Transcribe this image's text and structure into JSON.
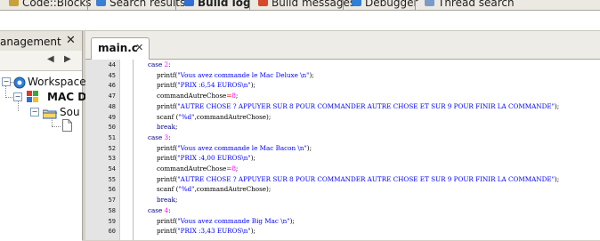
{
  "top_tabs": [
    {
      "label": "Code::Blocks",
      "icon": "codeblocks-icon",
      "active": false
    },
    {
      "label": "Search results",
      "icon": "search-results-icon",
      "active": false
    },
    {
      "label": "Build log",
      "icon": "build-log-icon",
      "active": true
    },
    {
      "label": "Build messages",
      "icon": "build-messages-icon",
      "active": false
    },
    {
      "label": "Debugger",
      "icon": "debugger-icon",
      "active": false
    },
    {
      "label": "Thread search",
      "icon": "thread-search-icon",
      "active": false
    }
  ],
  "management": {
    "title": "anagement",
    "close": "✕",
    "nav_prev": "◀",
    "nav_next": "▶",
    "tree": {
      "workspace": "Workspace",
      "project": "MAC D",
      "sources": "Sou"
    }
  },
  "editor": {
    "file_tab": "main.c",
    "file_tab_close": "✕",
    "lines": [
      {
        "n": "44",
        "indent": 0,
        "parts": [
          {
            "t": "case ",
            "c": "kw"
          },
          {
            "t": "2",
            "c": "num"
          },
          {
            "t": ":",
            "c": "pl"
          }
        ]
      },
      {
        "n": "45",
        "indent": 1,
        "parts": [
          {
            "t": "printf(",
            "c": "pl"
          },
          {
            "t": "\"Vous avez commande le Mac Deluxe \\n\"",
            "c": "str"
          },
          {
            "t": ");",
            "c": "pl"
          }
        ]
      },
      {
        "n": "46",
        "indent": 1,
        "parts": [
          {
            "t": "printf(",
            "c": "pl"
          },
          {
            "t": "\"PRIX :6,54 EUROS\\n\"",
            "c": "str"
          },
          {
            "t": ");",
            "c": "pl"
          }
        ]
      },
      {
        "n": "47",
        "indent": 1,
        "parts": [
          {
            "t": "commandAutreChose",
            "c": "pl"
          },
          {
            "t": "=",
            "c": "op"
          },
          {
            "t": "8",
            "c": "num"
          },
          {
            "t": ";",
            "c": "pl"
          }
        ]
      },
      {
        "n": "48",
        "indent": 1,
        "parts": [
          {
            "t": "printf(",
            "c": "pl"
          },
          {
            "t": "\"AUTRE CHOSE ? APPUYER SUR 8 POUR COMMANDER AUTRE CHOSE ET SUR 9 POUR FINIR LA COMMANDE\"",
            "c": "str"
          },
          {
            "t": ");",
            "c": "pl"
          }
        ]
      },
      {
        "n": "49",
        "indent": 1,
        "parts": [
          {
            "t": "scanf (",
            "c": "pl"
          },
          {
            "t": "\"%d\"",
            "c": "str"
          },
          {
            "t": ",commandAutreChose);",
            "c": "pl"
          }
        ]
      },
      {
        "n": "50",
        "indent": 1,
        "parts": [
          {
            "t": "break",
            "c": "kw"
          },
          {
            "t": ";",
            "c": "pl"
          }
        ]
      },
      {
        "n": "51",
        "indent": 0,
        "parts": [
          {
            "t": "case ",
            "c": "kw"
          },
          {
            "t": "3",
            "c": "num"
          },
          {
            "t": ":",
            "c": "pl"
          }
        ]
      },
      {
        "n": "52",
        "indent": 1,
        "parts": [
          {
            "t": "printf(",
            "c": "pl"
          },
          {
            "t": "\"Vous avez commande le Mac Bacon \\n\"",
            "c": "str"
          },
          {
            "t": ");",
            "c": "pl"
          }
        ]
      },
      {
        "n": "53",
        "indent": 1,
        "parts": [
          {
            "t": "printf(",
            "c": "pl"
          },
          {
            "t": "\"PRIX :4,00 EUROS\\n\"",
            "c": "str"
          },
          {
            "t": ");",
            "c": "pl"
          }
        ]
      },
      {
        "n": "54",
        "indent": 1,
        "parts": [
          {
            "t": "commandAutreChose",
            "c": "pl"
          },
          {
            "t": "=",
            "c": "op"
          },
          {
            "t": "8",
            "c": "num"
          },
          {
            "t": ";",
            "c": "pl"
          }
        ]
      },
      {
        "n": "55",
        "indent": 1,
        "parts": [
          {
            "t": "printf(",
            "c": "pl"
          },
          {
            "t": "\"AUTRE CHOSE ? APPUYER SUR 8 POUR COMMANDER AUTRE CHOSE ET SUR 9 POUR FINIR LA COMMANDE\"",
            "c": "str"
          },
          {
            "t": ");",
            "c": "pl"
          }
        ]
      },
      {
        "n": "56",
        "indent": 1,
        "parts": [
          {
            "t": "scanf (",
            "c": "pl"
          },
          {
            "t": "\"%d\"",
            "c": "str"
          },
          {
            "t": ",commandAutreChose);",
            "c": "pl"
          }
        ]
      },
      {
        "n": "57",
        "indent": 1,
        "parts": [
          {
            "t": "break",
            "c": "kw"
          },
          {
            "t": ";",
            "c": "pl"
          }
        ]
      },
      {
        "n": "58",
        "indent": 0,
        "parts": [
          {
            "t": "case ",
            "c": "kw"
          },
          {
            "t": "4",
            "c": "num"
          },
          {
            "t": ":",
            "c": "pl"
          }
        ]
      },
      {
        "n": "59",
        "indent": 1,
        "parts": [
          {
            "t": "printf(",
            "c": "pl"
          },
          {
            "t": "\"Vous avez commande Big Mac \\n\"",
            "c": "str"
          },
          {
            "t": ");",
            "c": "pl"
          }
        ]
      },
      {
        "n": "60",
        "indent": 1,
        "parts": [
          {
            "t": "printf(",
            "c": "pl"
          },
          {
            "t": "\"PRIX :3,43 EUROS\\n\"",
            "c": "str"
          },
          {
            "t": ");",
            "c": "pl"
          }
        ]
      }
    ]
  },
  "colors": {
    "keyword": "#00008b",
    "string": "#0000ff",
    "number": "#ff00ff",
    "operator": "#ff0000"
  }
}
